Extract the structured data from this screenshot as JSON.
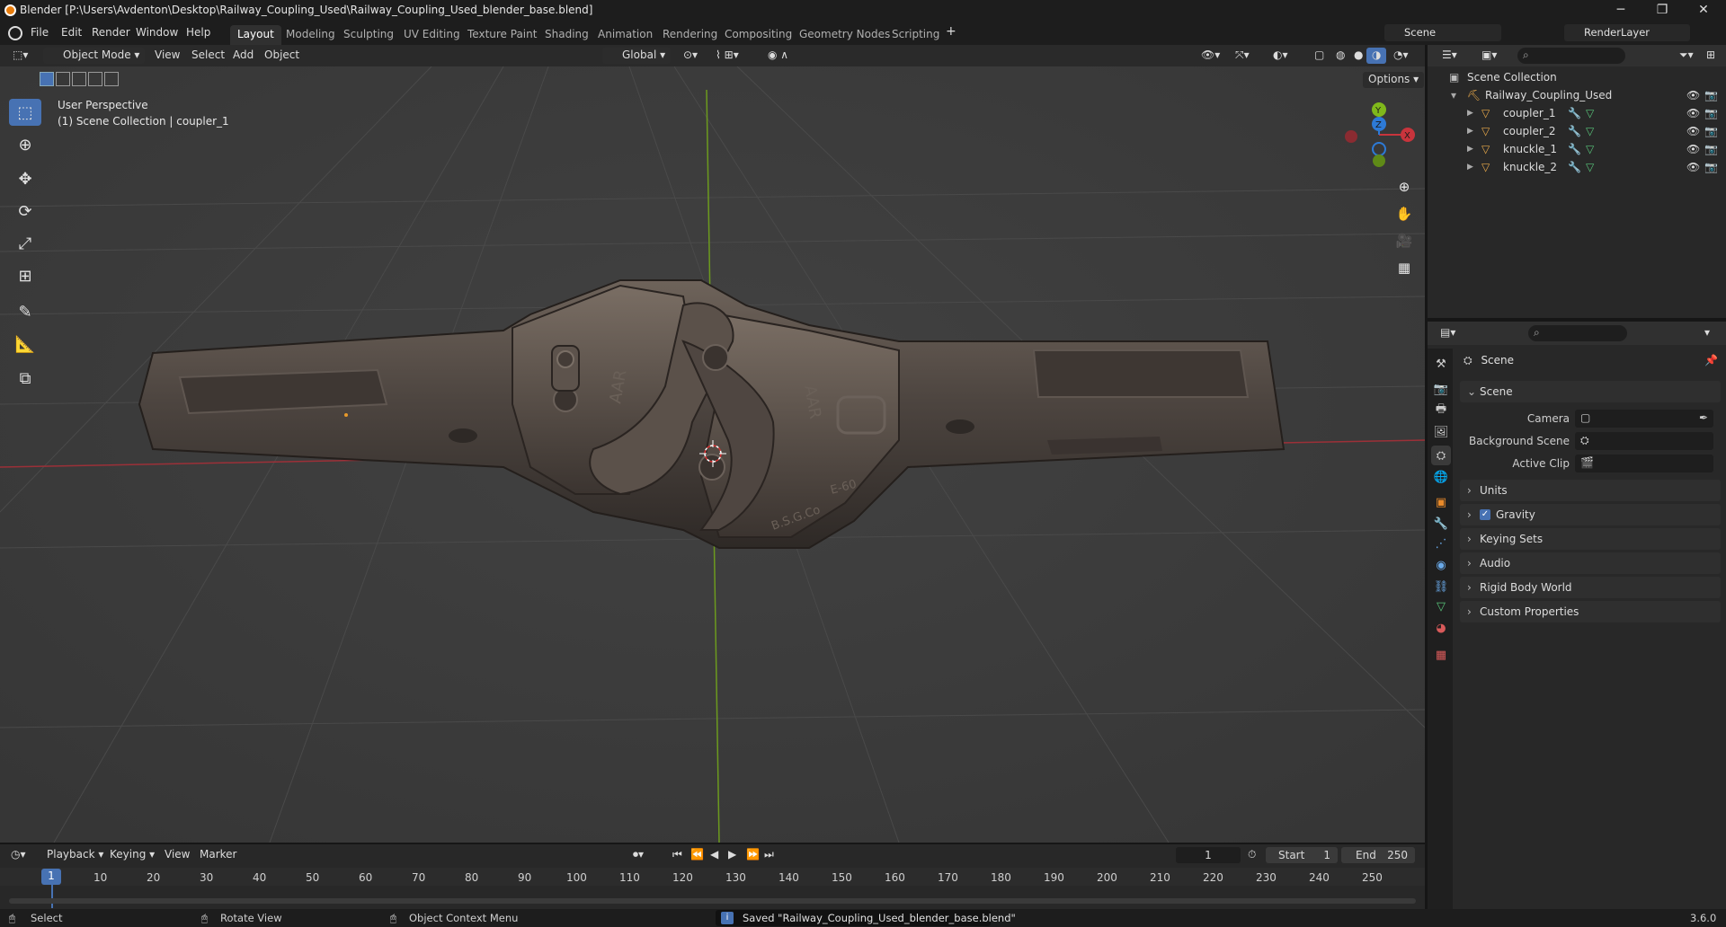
{
  "window": {
    "title": "Blender [P:\\Users\\Avdenton\\Desktop\\Railway_Coupling_Used\\Railway_Coupling_Used_blender_base.blend]",
    "minimize": "─",
    "maximize": "❐",
    "close": "✕"
  },
  "menu": [
    "File",
    "Edit",
    "Render",
    "Window",
    "Help"
  ],
  "workspaces": [
    "Layout",
    "Modeling",
    "Sculpting",
    "UV Editing",
    "Texture Paint",
    "Shading",
    "Animation",
    "Rendering",
    "Compositing",
    "Geometry Nodes",
    "Scripting"
  ],
  "active_workspace": "Layout",
  "add_workspace": "+",
  "scene_field": "Scene",
  "view_layer_field": "RenderLayer",
  "viewport": {
    "mode": "Object Mode",
    "menus": [
      "View",
      "Select",
      "Add",
      "Object"
    ],
    "orientation": "Global",
    "options": "Options",
    "info_line1": "User Perspective",
    "info_line2": "(1) Scene Collection | coupler_1",
    "gizmo": {
      "x": "X",
      "y": "Y",
      "z": "Z"
    },
    "cast_text": {
      "aar_left": "AAR",
      "aar_right": "AAR",
      "model": "E-60",
      "maker": "B.S.G.Co"
    }
  },
  "outliner": {
    "root": "Scene Collection",
    "collection": "Railway_Coupling_Used",
    "objects": [
      "coupler_1",
      "coupler_2",
      "knuckle_1",
      "knuckle_2"
    ]
  },
  "properties": {
    "header": "Scene",
    "section": "Scene",
    "fields": [
      {
        "label": "Camera"
      },
      {
        "label": "Background Scene"
      },
      {
        "label": "Active Clip"
      }
    ],
    "panels": [
      "Units",
      "Gravity",
      "Keying Sets",
      "Audio",
      "Rigid Body World",
      "Custom Properties"
    ],
    "gravity_checked": true
  },
  "timeline": {
    "menus": [
      "Playback",
      "Keying",
      "View",
      "Marker"
    ],
    "current_frame": "1",
    "start_label": "Start",
    "start": "1",
    "end_label": "End",
    "end": "250",
    "ruler": [
      "1",
      "10",
      "20",
      "30",
      "40",
      "50",
      "60",
      "70",
      "80",
      "90",
      "100",
      "110",
      "120",
      "130",
      "140",
      "150",
      "160",
      "170",
      "180",
      "190",
      "200",
      "210",
      "220",
      "230",
      "240",
      "250"
    ]
  },
  "status": {
    "select": "Select",
    "rotate": "Rotate View",
    "context": "Object Context Menu",
    "message": "Saved \"Railway_Coupling_Used_blender_base.blend\"",
    "version": "3.6.0"
  },
  "colors": {
    "accent": "#4772b3",
    "brand_orange": "#e87d0d",
    "x_axis": "#c8343c",
    "y_axis": "#7fb81b",
    "z_axis": "#2d7ad6"
  }
}
